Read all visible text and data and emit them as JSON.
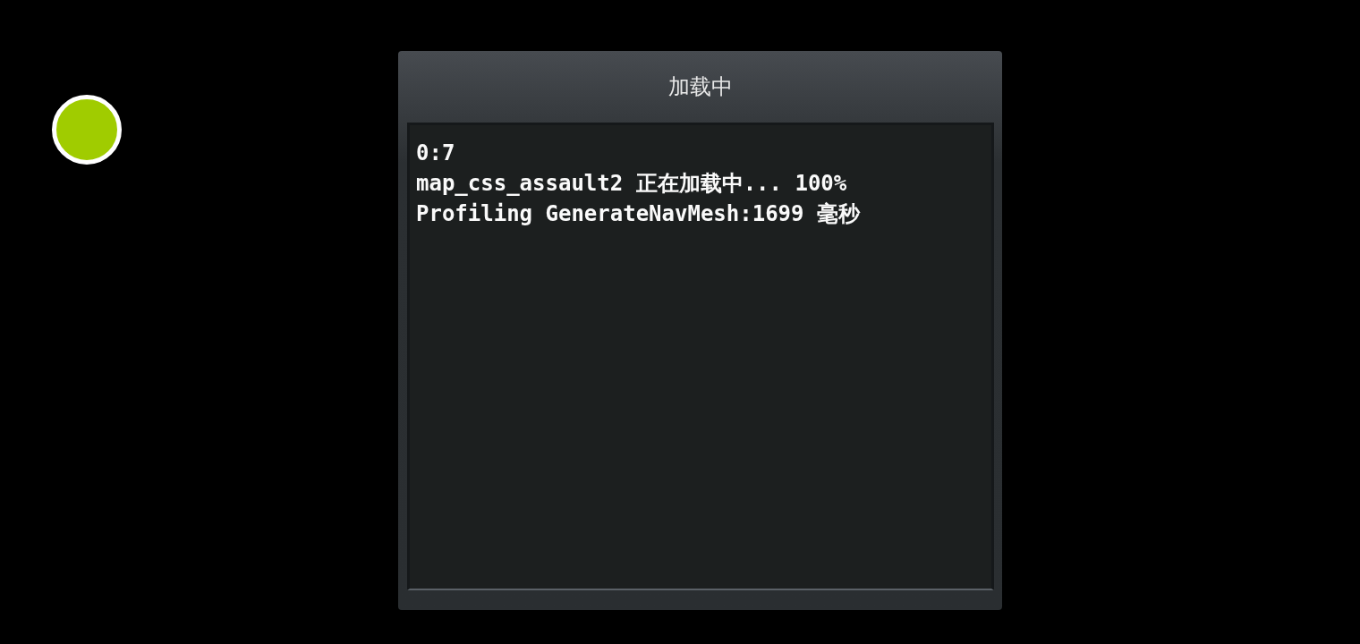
{
  "status_indicator": {
    "color": "#a0cc00"
  },
  "dialog": {
    "title": "加载中",
    "log_lines": [
      "0:7",
      "map_css_assault2 正在加载中... 100%",
      "Profiling GenerateNavMesh:1699 毫秒"
    ]
  }
}
